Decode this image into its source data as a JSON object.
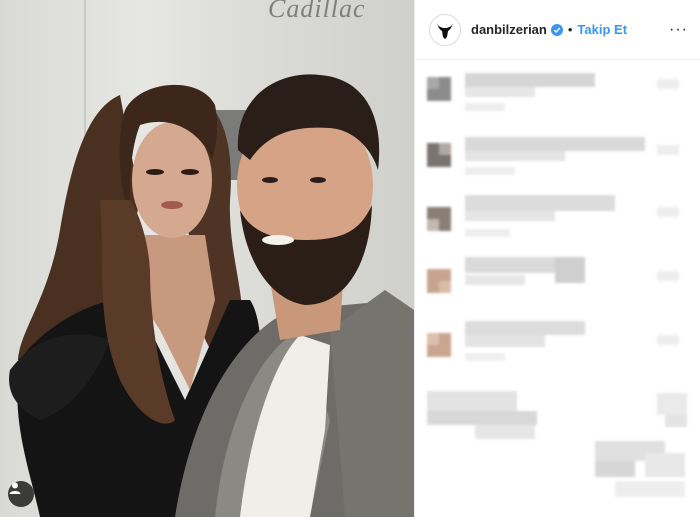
{
  "photo": {
    "background_text": "Cadillac",
    "user_tag_icon": "person-icon"
  },
  "post_header": {
    "avatar_icon": "goat-skull-icon",
    "username": "danbilzerian",
    "verified_icon": "verified-badge-icon",
    "separator": "•",
    "follow_label": "Takip Et",
    "more_icon": "ellipsis-icon",
    "more_label": "···"
  },
  "comments": {
    "state": "pixelated",
    "count": 6
  },
  "colors": {
    "accent": "#3897f0",
    "text": "#262626",
    "border": "#efefef"
  }
}
